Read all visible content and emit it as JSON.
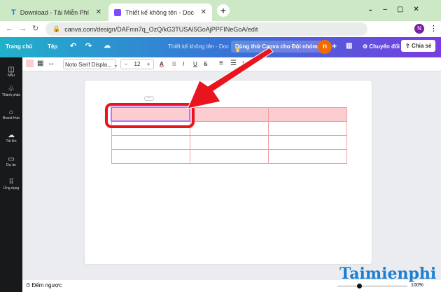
{
  "browser": {
    "tabs": [
      {
        "title": "Download - Tải Miễn Phí VN - Ph"
      },
      {
        "title": "Thiết kế không tên - Doc"
      }
    ],
    "url": "canva.com/design/DAFmn7q_OzQ/kG3TUSAI5GoAjPPFINeGoA/edit",
    "profile": "N"
  },
  "header": {
    "home": "Trang chủ",
    "file": "Tệp",
    "doc_title": "Thiết kế không tên - Doc",
    "trial": "Dùng thử Canva cho Đội nhóm",
    "avatar": "n",
    "convert": "Chuyển đổi",
    "share": "Chia sẻ"
  },
  "toolbar": {
    "font": "Noto Serif Displa...",
    "size": "12",
    "bold": "B",
    "italic": "I",
    "underline": "U",
    "strike": "S"
  },
  "sidebar": [
    "Mẫu",
    "Thành phần",
    "Brand Hub",
    "Tải lên",
    "Dự án",
    "Ứng dụng"
  ],
  "bottom": {
    "timer": "Đếm ngược",
    "zoom": "100%"
  },
  "watermark": "Taimienphi.vn",
  "colors": {
    "cell": "#fbcdd0",
    "highlight": "#e8141e"
  }
}
